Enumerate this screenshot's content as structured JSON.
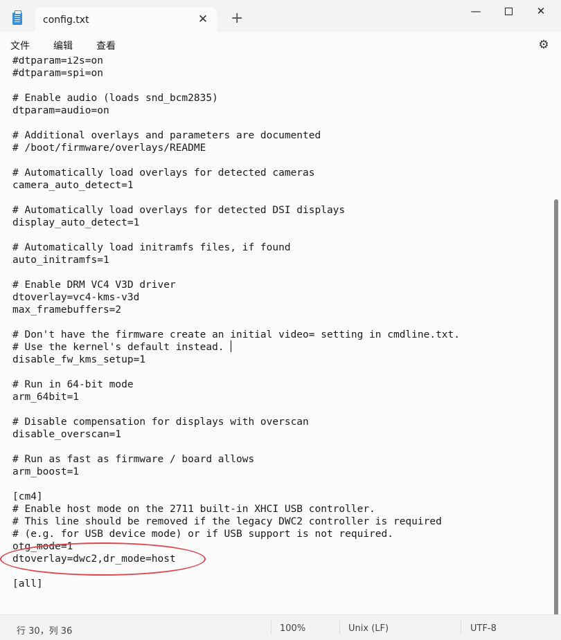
{
  "tab": {
    "title": "config.txt",
    "close_glyph": "✕",
    "add_glyph": "+"
  },
  "window": {
    "minimize_glyph": "—",
    "close_glyph": "✕"
  },
  "menu": {
    "file": "文件",
    "edit": "编辑",
    "view": "查看",
    "settings_glyph": "⚙"
  },
  "editor": {
    "lines": [
      "#dtparam=i2s=on",
      "#dtparam=spi=on",
      "",
      "# Enable audio (loads snd_bcm2835)",
      "dtparam=audio=on",
      "",
      "# Additional overlays and parameters are documented",
      "# /boot/firmware/overlays/README",
      "",
      "# Automatically load overlays for detected cameras",
      "camera_auto_detect=1",
      "",
      "# Automatically load overlays for detected DSI displays",
      "display_auto_detect=1",
      "",
      "# Automatically load initramfs files, if found",
      "auto_initramfs=1",
      "",
      "# Enable DRM VC4 V3D driver",
      "dtoverlay=vc4-kms-v3d",
      "max_framebuffers=2",
      "",
      "# Don't have the firmware create an initial video= setting in cmdline.txt.",
      "# Use the kernel's default instead.",
      "disable_fw_kms_setup=1",
      "",
      "# Run in 64-bit mode",
      "arm_64bit=1",
      "",
      "# Disable compensation for displays with overscan",
      "disable_overscan=1",
      "",
      "# Run as fast as firmware / board allows",
      "arm_boost=1",
      "",
      "[cm4]",
      "# Enable host mode on the 2711 built-in XHCI USB controller.",
      "# This line should be removed if the legacy DWC2 controller is required",
      "# (e.g. for USB device mode) or if USB support is not required.",
      "otg_mode=1",
      "dtoverlay=dwc2,dr_mode=host",
      "",
      "[all]"
    ]
  },
  "status": {
    "position": "行 30，列 36",
    "zoom": "100%",
    "line_ending": "Unix (LF)",
    "encoding": "UTF-8"
  },
  "colors": {
    "annotation": "#e2444c"
  }
}
